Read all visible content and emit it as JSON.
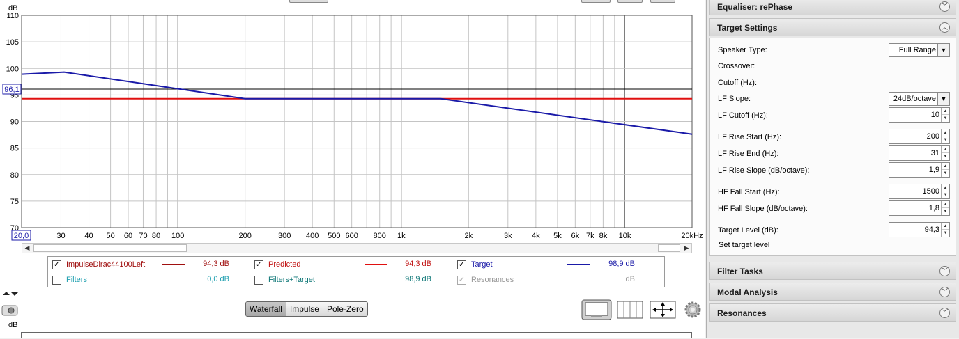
{
  "chart_data": {
    "type": "line",
    "ylabel": "dB",
    "ylim": [
      70,
      110
    ],
    "y_ticks": [
      "110",
      "105",
      "100",
      "95",
      "90",
      "85",
      "80",
      "75",
      "70"
    ],
    "x_scale": "log",
    "xlim": [
      20,
      20000
    ],
    "x_tick_labels": [
      {
        "f": 30,
        "label": "30"
      },
      {
        "f": 40,
        "label": "40"
      },
      {
        "f": 50,
        "label": "50"
      },
      {
        "f": 60,
        "label": "60"
      },
      {
        "f": 70,
        "label": "70"
      },
      {
        "f": 80,
        "label": "80"
      },
      {
        "f": 100,
        "label": "100"
      },
      {
        "f": 200,
        "label": "200"
      },
      {
        "f": 300,
        "label": "300"
      },
      {
        "f": 400,
        "label": "400"
      },
      {
        "f": 500,
        "label": "500"
      },
      {
        "f": 600,
        "label": "600"
      },
      {
        "f": 800,
        "label": "800"
      },
      {
        "f": 1000,
        "label": "1k"
      },
      {
        "f": 2000,
        "label": "2k"
      },
      {
        "f": 3000,
        "label": "3k"
      },
      {
        "f": 4000,
        "label": "4k"
      },
      {
        "f": 5000,
        "label": "5k"
      },
      {
        "f": 6000,
        "label": "6k"
      },
      {
        "f": 7000,
        "label": "7k"
      },
      {
        "f": 8000,
        "label": "8k"
      },
      {
        "f": 10000,
        "label": "10k"
      },
      {
        "f": 20000,
        "label": "20kHz"
      }
    ],
    "x_start_label": "20,0",
    "y_marker_label": "96,1",
    "y_marker_value": 96.1,
    "grid": true,
    "series": [
      {
        "name": "Predicted",
        "color": "#e01010",
        "x": [
          20,
          20000
        ],
        "y": [
          94.3,
          94.3
        ]
      },
      {
        "name": "Target",
        "color": "#1a1aa8",
        "x": [
          20,
          31,
          200,
          1500,
          20000
        ],
        "y": [
          98.9,
          99.3,
          94.3,
          94.3,
          87.6
        ]
      }
    ]
  },
  "legend": {
    "items": [
      {
        "label": "ImpulseDirac44100Left",
        "checked": true,
        "value": "94,3 dB",
        "color": "#a01010",
        "swatch": "#a01010"
      },
      {
        "label": "Predicted",
        "checked": true,
        "value": "94,3 dB",
        "color": "#c01010",
        "swatch": "#e01010"
      },
      {
        "label": "Target",
        "checked": true,
        "value": "98,9 dB",
        "color": "#1a1aa8",
        "swatch": "#1a1aa8"
      },
      {
        "label": "Filters",
        "checked": false,
        "value": "0,0 dB",
        "color": "#20a0b0"
      },
      {
        "label": "Filters+Target",
        "checked": false,
        "value": "98,9 dB",
        "color": "#107878"
      },
      {
        "label": "Resonances",
        "checked": true,
        "disabled": true,
        "value": "dB",
        "color": "#999999"
      }
    ]
  },
  "bottom": {
    "tabs": [
      "Waterfall",
      "Impulse",
      "Pole-Zero"
    ],
    "active_tab": "Waterfall",
    "db_label": "dB"
  },
  "panel": {
    "equaliser_title": "Equaliser: rePhase",
    "target_title": "Target Settings",
    "rows": {
      "speaker_type": "Speaker Type:",
      "speaker_type_value": "Full Range",
      "crossover": "Crossover:",
      "cutoff": "Cutoff (Hz):",
      "lf_slope": "LF Slope:",
      "lf_slope_value": "24dB/octave",
      "lf_cutoff": "LF Cutoff (Hz):",
      "lf_cutoff_value": "10",
      "lf_rise_start": "LF Rise Start (Hz):",
      "lf_rise_start_value": "200",
      "lf_rise_end": "LF Rise End (Hz):",
      "lf_rise_end_value": "31",
      "lf_rise_slope": "LF Rise Slope (dB/octave):",
      "lf_rise_slope_value": "1,9",
      "hf_fall_start": "HF Fall Start (Hz):",
      "hf_fall_start_value": "1500",
      "hf_fall_slope": "HF Fall Slope (dB/octave):",
      "hf_fall_slope_value": "1,8",
      "target_level": "Target Level (dB):",
      "target_level_value": "94,3",
      "set_target": "Set target level"
    },
    "filter_tasks": "Filter Tasks",
    "modal_analysis": "Modal Analysis",
    "resonances": "Resonances"
  }
}
